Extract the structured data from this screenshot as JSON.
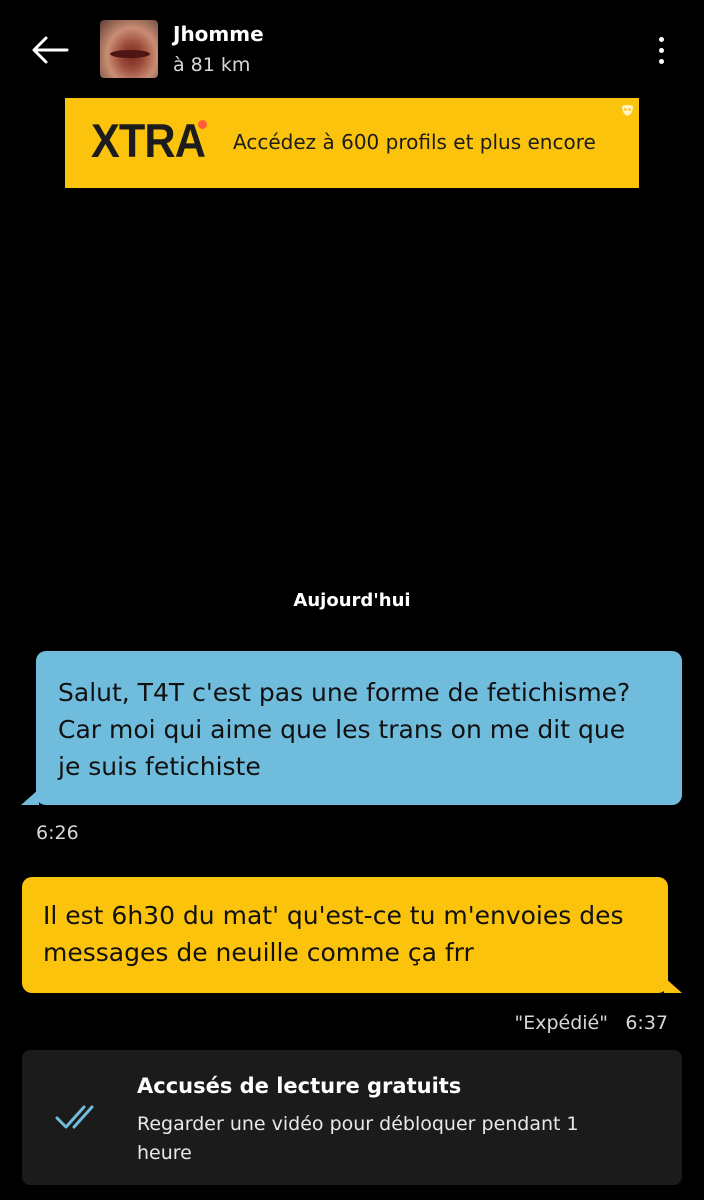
{
  "header": {
    "name": "Jhomme",
    "distance": "à 81 km",
    "back_icon": "arrow-left-icon",
    "menu_icon": "more-vertical-icon"
  },
  "banner": {
    "logo_text": "XTRA",
    "text": "Accédez à 600 profils et plus encore",
    "background_color": "#fcc30c",
    "dot_color": "#ff5e3a"
  },
  "conversation": {
    "date_separator": "Aujourd'hui",
    "messages": [
      {
        "direction": "incoming",
        "text": "Salut, T4T c'est pas une forme de fetichisme?\nCar moi qui aime que les trans on me dit que\nje suis fetichiste",
        "time": "6:26",
        "bubble_color": "#6fbcdd"
      },
      {
        "direction": "outgoing",
        "text": "Il est 6h30 du mat' qu'est-ce tu m'envoies des\nmessages de neuille comme ça frr",
        "status": "\"Expédié\"",
        "time": "6:37",
        "bubble_color": "#fcc30c"
      }
    ]
  },
  "receipts_card": {
    "title": "Accusés de lecture gratuits",
    "description": "Regarder une vidéo pour débloquer pendant 1 heure",
    "icon": "double-check-icon",
    "icon_color": "#6fbcdd"
  }
}
